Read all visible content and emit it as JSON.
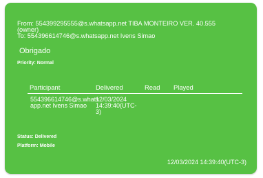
{
  "message": {
    "from_line": "From: 554399295555@s.whatsapp.net TIBA MONTEIRO VER. 40.555",
    "owner_tag": "(owner)",
    "to_line": "To: 554396614746@s.whatsapp.net Ivens Simao",
    "body": "Obrigado",
    "priority_label": "Priority:",
    "priority_value": "Normal",
    "table": {
      "headers": [
        "Participant",
        "Delivered",
        "Read",
        "Played"
      ],
      "rows": [
        {
          "participant_line1": "554396614746@s.whats",
          "participant_line2": "app.net Ivens Simao",
          "delivered_line1": "12/03/2024",
          "delivered_line2": "14:39:40(UTC-",
          "delivered_line3": "3)",
          "read": "",
          "played": ""
        }
      ]
    },
    "status_label": "Status:",
    "status_value": "Delivered",
    "platform_label": "Platform:",
    "platform_value": "Mobile",
    "timestamp": "12/03/2024 14:39:40(UTC-3)"
  },
  "colors": {
    "bubble": "#57c144",
    "text": "#ffffff"
  }
}
